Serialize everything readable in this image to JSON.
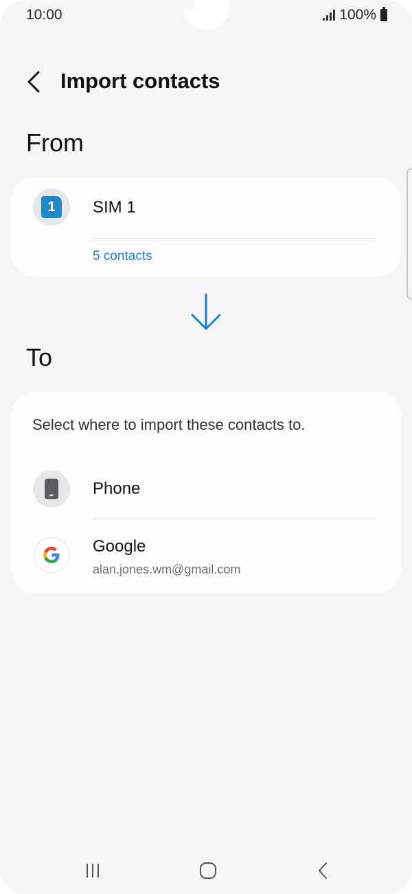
{
  "status_bar": {
    "time": "10:00",
    "battery": "100%",
    "icons": [
      "signal-icon",
      "battery-icon"
    ]
  },
  "header": {
    "back_icon": "chevron-left-icon",
    "title": "Import contacts"
  },
  "from_section": {
    "heading": "From",
    "source": {
      "icon": "sim-card-icon",
      "badge": "1",
      "name": "SIM 1",
      "contacts": "5 contacts"
    }
  },
  "arrow_icon": "arrow-down-icon",
  "to_section": {
    "heading": "To",
    "prompt": "Select where to import these contacts to.",
    "options": [
      {
        "icon": "phone-icon",
        "label": "Phone"
      },
      {
        "icon": "google-icon",
        "label": "Google",
        "account": "alan.jones.wm@gmail.com"
      }
    ]
  },
  "nav_bar": {
    "items": [
      "recents-icon",
      "home-icon",
      "back-icon"
    ]
  },
  "colors": {
    "accent": "#1a7fd6",
    "sim_badge": "#1e88c9",
    "background": "#f5f5f7",
    "card": "#fcfcfe"
  }
}
